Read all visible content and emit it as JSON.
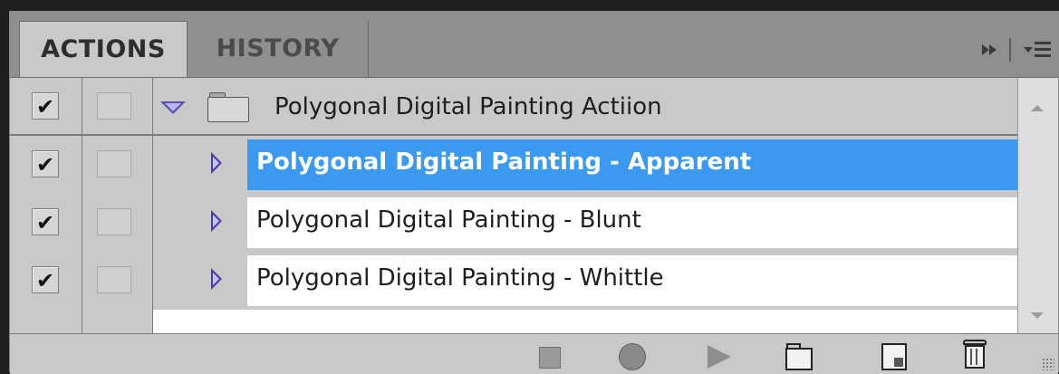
{
  "tabs": {
    "actions_label": "ACTIONS",
    "history_label": "HISTORY"
  },
  "set": {
    "label": "Polygonal Digital Painting Actiion",
    "toggle_checked": true,
    "icon": "folder-icon"
  },
  "actions": [
    {
      "label": "Polygonal Digital Painting - Apparent",
      "checked": true,
      "selected": true
    },
    {
      "label": "Polygonal Digital Painting - Blunt",
      "checked": true,
      "selected": false
    },
    {
      "label": "Polygonal Digital Painting - Whittle",
      "checked": true,
      "selected": false
    }
  ],
  "glyphs": {
    "check": "✔"
  },
  "colors": {
    "selection": "#3c99f0",
    "disclosure": "#4a3fa8"
  },
  "toolbar": {
    "icons": [
      "stop-icon",
      "record-icon",
      "play-icon",
      "new-set-icon",
      "new-action-icon",
      "trash-icon"
    ]
  }
}
